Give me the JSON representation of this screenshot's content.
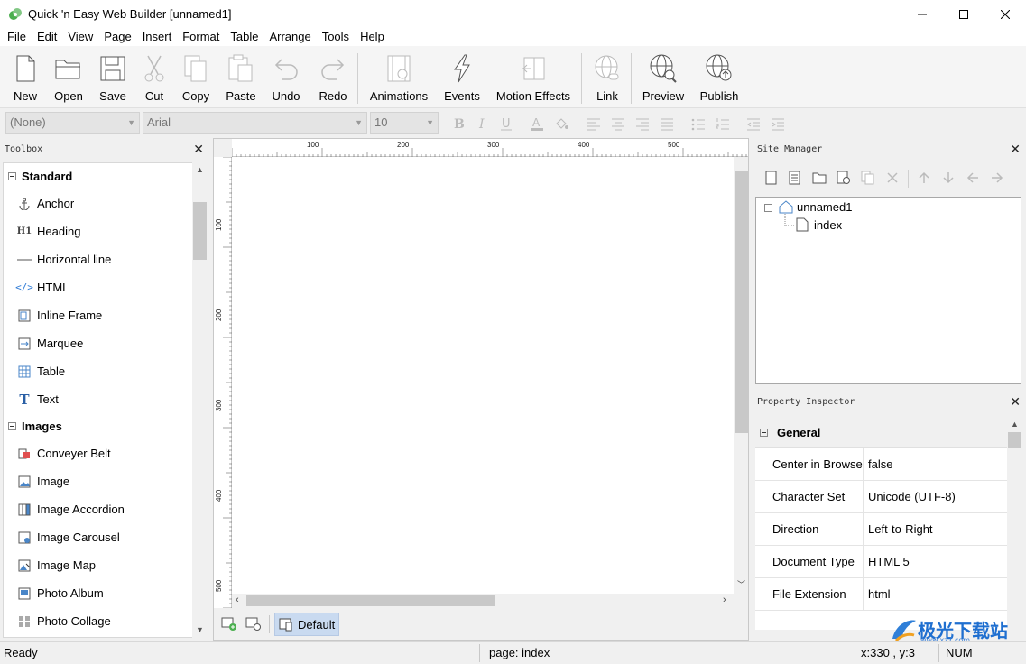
{
  "window": {
    "title": "Quick 'n Easy Web Builder [unnamed1]"
  },
  "menu": [
    "File",
    "Edit",
    "View",
    "Page",
    "Insert",
    "Format",
    "Table",
    "Arrange",
    "Tools",
    "Help"
  ],
  "toolbar": {
    "new": "New",
    "open": "Open",
    "save": "Save",
    "cut": "Cut",
    "copy": "Copy",
    "paste": "Paste",
    "undo": "Undo",
    "redo": "Redo",
    "animations": "Animations",
    "events": "Events",
    "motion_effects": "Motion Effects",
    "link": "Link",
    "preview": "Preview",
    "publish": "Publish"
  },
  "format": {
    "style": "(None)",
    "font": "Arial",
    "size": "10"
  },
  "toolbox": {
    "title": "Toolbox",
    "categories": [
      {
        "name": "Standard",
        "items": [
          "Anchor",
          "Heading",
          "Horizontal line",
          "HTML",
          "Inline Frame",
          "Marquee",
          "Table",
          "Text"
        ]
      },
      {
        "name": "Images",
        "items": [
          "Conveyer Belt",
          "Image",
          "Image Accordion",
          "Image Carousel",
          "Image Map",
          "Photo Album",
          "Photo Collage"
        ]
      }
    ]
  },
  "ruler": {
    "top": [
      "100",
      "200",
      "300",
      "400",
      "500"
    ],
    "left": [
      "100",
      "200",
      "300",
      "400",
      "500"
    ]
  },
  "canvas": {
    "layout_button": "Default"
  },
  "site_manager": {
    "title": "Site Manager",
    "root": "unnamed1",
    "page": "index"
  },
  "property_inspector": {
    "title": "Property Inspector",
    "category": "General",
    "rows": [
      {
        "name": "Center in Browse",
        "value": "false"
      },
      {
        "name": "Character Set",
        "value": "Unicode (UTF-8)"
      },
      {
        "name": "Direction",
        "value": "Left-to-Right"
      },
      {
        "name": "Document Type",
        "value": "HTML 5"
      },
      {
        "name": "File Extension",
        "value": "html"
      }
    ]
  },
  "status": {
    "ready": "Ready",
    "page": "page: index",
    "coords": "x:330 , y:3",
    "num": "NUM"
  },
  "watermark": {
    "text": "极光下载站",
    "sub": "www.xz7.com"
  }
}
